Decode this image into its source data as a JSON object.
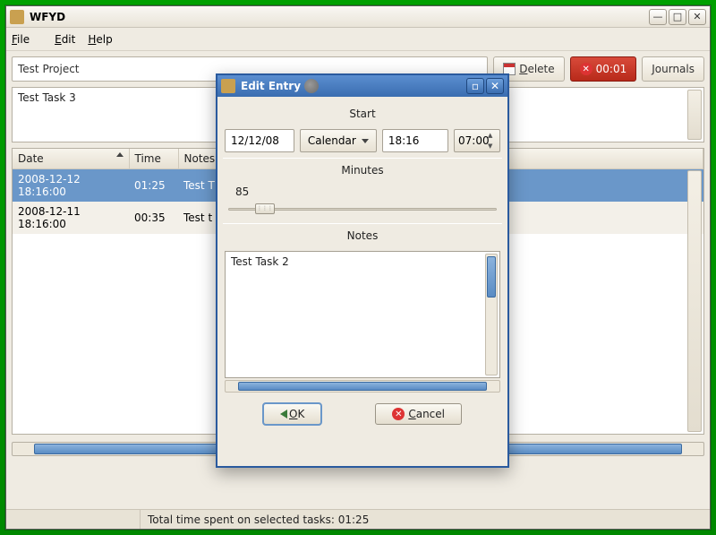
{
  "window": {
    "title": "WFYD"
  },
  "menu": {
    "file": "File",
    "edit": "Edit",
    "help": "Help"
  },
  "toolbar": {
    "project": "Test Project",
    "delete": "Delete",
    "timer": "00:01",
    "journals": "Journals"
  },
  "task_text": "Test Task 3",
  "columns": {
    "date": "Date",
    "time": "Time",
    "notes": "Notes"
  },
  "rows": [
    {
      "date": "2008-12-12 18:16:00",
      "time": "01:25",
      "notes": "Test Task 2"
    },
    {
      "date": "2008-12-11 18:16:00",
      "time": "00:35",
      "notes": "Test task 1"
    }
  ],
  "status": "Total time spent on selected tasks: 01:25",
  "dialog": {
    "title": "Edit Entry",
    "start_label": "Start",
    "date": "12/12/08",
    "calendar_btn": "Calendar",
    "time1": "18:16",
    "time2": "07:00",
    "minutes_label": "Minutes",
    "minutes_value": "85",
    "notes_label": "Notes",
    "notes_text": "Test Task 2",
    "ok": "OK",
    "cancel": "Cancel"
  }
}
